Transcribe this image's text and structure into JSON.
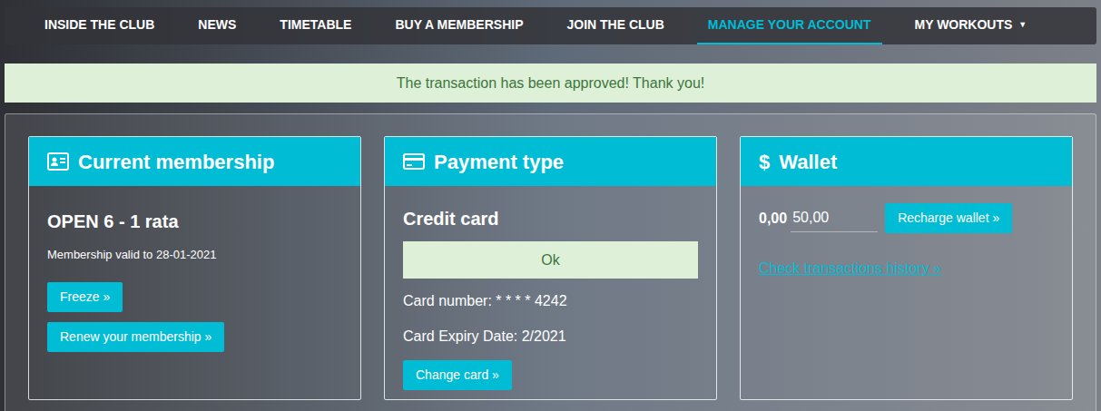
{
  "nav": {
    "items": [
      {
        "label": "INSIDE THE CLUB",
        "selected": false,
        "kind": "link"
      },
      {
        "label": "NEWS",
        "selected": false,
        "kind": "link"
      },
      {
        "label": "TIMETABLE",
        "selected": false,
        "kind": "link"
      },
      {
        "label": "BUY A MEMBERSHIP",
        "selected": false,
        "kind": "link"
      },
      {
        "label": "JOIN THE CLUB",
        "selected": false,
        "kind": "link"
      },
      {
        "label": "MANAGE YOUR ACCOUNT",
        "selected": true,
        "kind": "link"
      },
      {
        "label": "MY WORKOUTS",
        "selected": false,
        "kind": "dropdown",
        "caret": "▼"
      }
    ]
  },
  "alert": {
    "text": "The transaction has been approved! Thank you!"
  },
  "membership": {
    "title": "Current membership",
    "name": "OPEN 6 - 1 rata",
    "valid": "Membership valid to 28-01-2021",
    "buttons": [
      "Freeze »",
      "Renew your membership »"
    ]
  },
  "payment": {
    "title": "Payment type",
    "type": "Credit card",
    "status": "Ok",
    "card_number": "Card number: * * * * 4242",
    "expiry": "Card Expiry Date: 2/2021",
    "button": "Change card »"
  },
  "wallet": {
    "title": "Wallet",
    "icon": "$",
    "balance": "0,00",
    "input_value": "50,00",
    "button": "Recharge wallet »",
    "link": "Check transactions history »"
  }
}
